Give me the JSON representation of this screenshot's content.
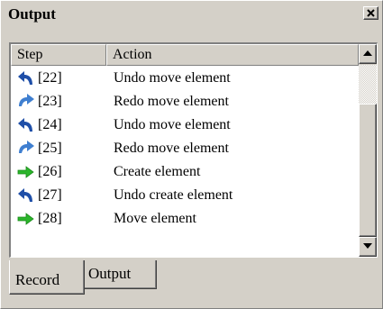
{
  "window": {
    "title": "Output"
  },
  "columns": {
    "step": "Step",
    "action": "Action"
  },
  "rows": [
    {
      "icon": "undo-icon",
      "step": "[22]",
      "action": "Undo move element"
    },
    {
      "icon": "redo-icon",
      "step": "[23]",
      "action": "Redo move element"
    },
    {
      "icon": "undo-icon",
      "step": "[24]",
      "action": "Undo move element"
    },
    {
      "icon": "redo-icon",
      "step": "[25]",
      "action": "Redo move element"
    },
    {
      "icon": "arrow-right-icon",
      "step": "[26]",
      "action": "Create element"
    },
    {
      "icon": "undo-icon",
      "step": "[27]",
      "action": "Undo create element"
    },
    {
      "icon": "arrow-right-icon",
      "step": "[28]",
      "action": "Move element"
    }
  ],
  "tabs": {
    "record": "Record",
    "output": "Output"
  },
  "colors": {
    "undo": "#1f4fa8",
    "redo": "#3f7fd0",
    "do": "#2bb52b"
  }
}
